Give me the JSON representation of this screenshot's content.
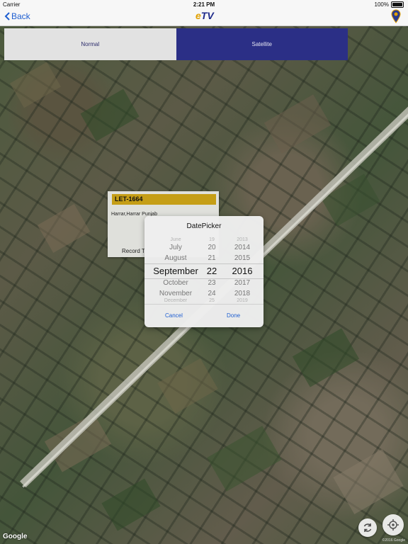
{
  "status_bar": {
    "carrier": "Carrier",
    "time": "2:21 PM",
    "battery": "100%"
  },
  "nav": {
    "back_label": "Back",
    "logo_text_a": "e",
    "logo_text_b": "TV"
  },
  "map_type": {
    "options": [
      "Normal",
      "Satellite"
    ],
    "selected": "Satellite"
  },
  "info_window": {
    "title": "LET-1664",
    "address": "Harrar,Harrar Punjab",
    "record_text": "Record T"
  },
  "date_picker": {
    "title": "DatePicker",
    "months": [
      "June",
      "July",
      "August",
      "September",
      "October",
      "November",
      "December"
    ],
    "days": [
      "19",
      "20",
      "21",
      "22",
      "23",
      "24",
      "25"
    ],
    "years": [
      "2013",
      "2014",
      "2015",
      "2016",
      "2017",
      "2018",
      "2019"
    ],
    "selected": {
      "month": "September",
      "day": "22",
      "year": "2016"
    },
    "cancel_label": "Cancel",
    "done_label": "Done"
  },
  "map": {
    "provider_label": "Google",
    "copyright": "©2016 Google"
  },
  "colors": {
    "accent": "#1f5fd1",
    "segment_selected": "#2b2f86",
    "info_title_bg": "#c59e16"
  }
}
